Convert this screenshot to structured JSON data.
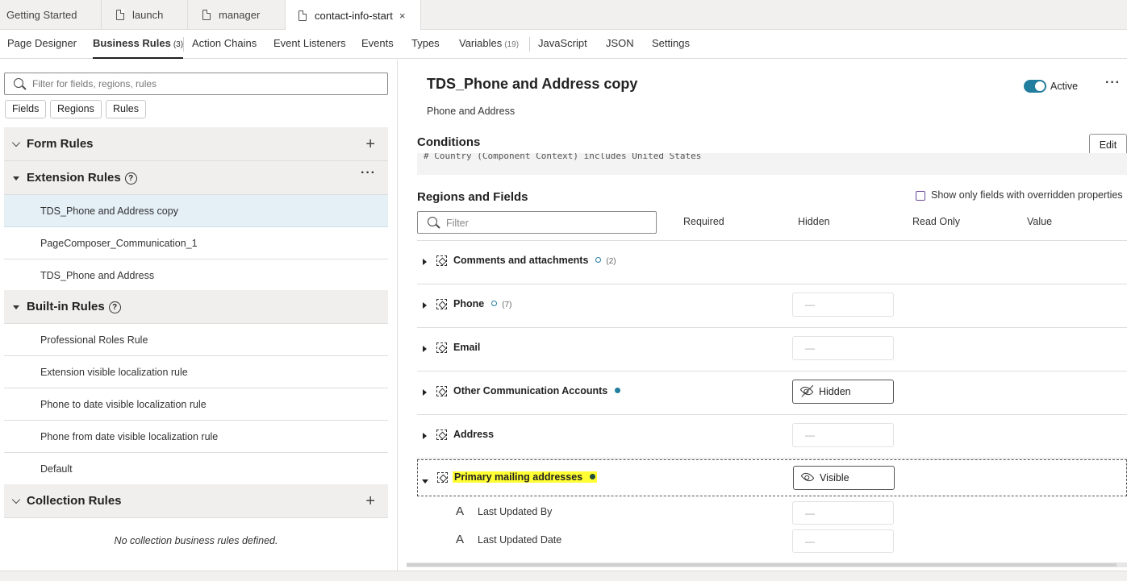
{
  "file_tabs": [
    {
      "label": "Getting Started"
    },
    {
      "label": "launch"
    },
    {
      "label": "manager"
    },
    {
      "label": "contact-info-start",
      "close": "×"
    }
  ],
  "nav_tabs": [
    {
      "label": "Page Designer"
    },
    {
      "label": "Business Rules",
      "count": "(3)"
    },
    {
      "label": "Action Chains"
    },
    {
      "label": "Event Listeners"
    },
    {
      "label": "Events"
    },
    {
      "label": "Types"
    },
    {
      "label": "Variables",
      "count": "(19)"
    },
    {
      "label": "JavaScript"
    },
    {
      "label": "JSON"
    },
    {
      "label": "Settings"
    }
  ],
  "left": {
    "search_placeholder": "Filter for fields, regions, rules",
    "chips": [
      "Fields",
      "Regions",
      "Rules"
    ],
    "form_rules": {
      "title": "Form Rules"
    },
    "extension_rules": {
      "title": "Extension Rules",
      "items": [
        "TDS_Phone and Address copy",
        "PageComposer_Communication_1",
        "TDS_Phone and Address"
      ]
    },
    "builtin_rules": {
      "title": "Built-in Rules",
      "items": [
        "Professional Roles Rule",
        "Extension visible localization rule",
        "Phone to date visible localization rule",
        "Phone from date visible localization rule",
        "Default"
      ]
    },
    "collection_rules": {
      "title": "Collection Rules",
      "empty": "No collection business rules defined."
    },
    "help_glyph": "?",
    "plus_glyph": "+",
    "dots_glyph": "···"
  },
  "right": {
    "title": "TDS_Phone and Address copy",
    "subtitle": "Phone and Address",
    "active_label": "Active",
    "more_glyph": "···",
    "conditions_title": "Conditions",
    "edit_label": "Edit",
    "condition_text": "# Country (Component Context) includes United States",
    "regions_title": "Regions and Fields",
    "override_label": "Show only fields with overridden properties",
    "filter_placeholder": "Filter",
    "columns": [
      "Required",
      "Hidden",
      "Read Only",
      "Value"
    ],
    "rows": [
      {
        "name": "Comments and attachments",
        "count": "(2)",
        "dash": ""
      },
      {
        "name": "Phone",
        "count": "(7)",
        "dash": "—"
      },
      {
        "name": "Email",
        "count": "",
        "dash": "—"
      },
      {
        "name": "Other Communication Accounts",
        "count": "",
        "button": "Hidden"
      },
      {
        "name": "Address",
        "count": "",
        "dash": "—"
      },
      {
        "name": "Primary mailing addresses",
        "count": "",
        "button": "Visible"
      }
    ],
    "sub_rows": [
      {
        "glyph": "A",
        "label": "Last Updated By",
        "dash": "—"
      },
      {
        "glyph": "A",
        "label": "Last Updated Date",
        "dash": "—"
      }
    ]
  },
  "colors": {
    "accent": "#227e9e",
    "highlight": "#ffff33",
    "selected_row": "#e4eff6"
  }
}
